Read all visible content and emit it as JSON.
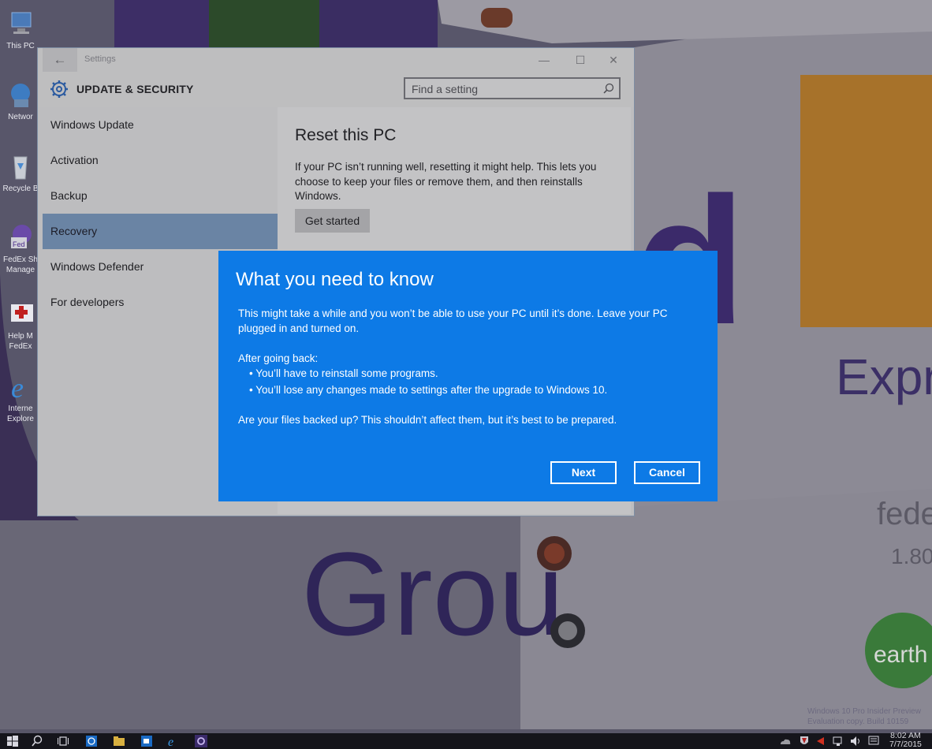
{
  "desktop": {
    "icons": [
      {
        "label": "This PC",
        "icon": "this-pc-icon"
      },
      {
        "label": "Networ",
        "icon": "network-icon"
      },
      {
        "label": "Recycle B",
        "icon": "recycle-bin-icon"
      },
      {
        "label": "FedEx Sh\nManage",
        "icon": "fedex-ship-manager-icon"
      },
      {
        "label": "Help M\nFedEx",
        "icon": "help-fedex-icon"
      },
      {
        "label": "Interne\nExplore",
        "icon": "internet-explorer-icon"
      }
    ]
  },
  "window": {
    "title": "Settings",
    "header_title": "UPDATE & SECURITY",
    "search": {
      "placeholder": "Find a setting",
      "value": ""
    },
    "sidebar": {
      "items": [
        {
          "label": "Windows Update",
          "selected": false
        },
        {
          "label": "Activation",
          "selected": false
        },
        {
          "label": "Backup",
          "selected": false
        },
        {
          "label": "Recovery",
          "selected": true
        },
        {
          "label": "Windows Defender",
          "selected": false
        },
        {
          "label": "For developers",
          "selected": false
        }
      ]
    },
    "content": {
      "heading": "Reset this PC",
      "description": "If your PC isn’t running well, resetting it might help. This lets you choose to keep your files or remove them, and then reinstalls Windows.",
      "button_label": "Get started"
    }
  },
  "dialog": {
    "title": "What you need to know",
    "paragraph1": "This might take a while and you won’t be able to use your PC until it’s done. Leave your PC plugged in and turned on.",
    "after_heading": "After going back:",
    "bullets": [
      "You’ll have to reinstall some programs.",
      "You’ll lose any changes made to settings after the upgrade to Windows 10."
    ],
    "paragraph3": "Are your files backed up? This shouldn’t affect them, but it’s best to be prepared.",
    "next_label": "Next",
    "cancel_label": "Cancel",
    "accent_color": "#0d7ae6"
  },
  "watermark": "Windows 10 Pro Insider Preview\nEvaluation copy. Build 10159",
  "taskbar": {
    "time": "8:02 AM",
    "date": "7/7/2015"
  }
}
